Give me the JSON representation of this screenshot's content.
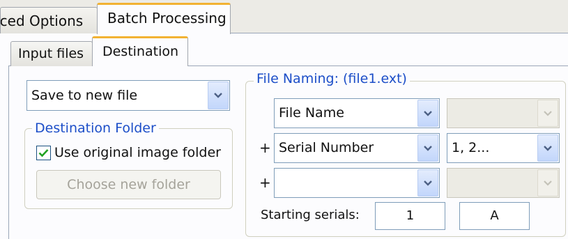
{
  "tabs": {
    "top": [
      {
        "label": "nced Options",
        "active": false
      },
      {
        "label": "Batch Processing",
        "active": true
      }
    ],
    "sub": [
      {
        "label": "Input files",
        "active": false
      },
      {
        "label": "Destination",
        "active": true
      }
    ]
  },
  "destination": {
    "save_mode": {
      "value": "Save to new file"
    },
    "folder_group": {
      "legend": "Destination Folder",
      "use_original": {
        "label": "Use original image folder",
        "checked": true
      },
      "choose_button": {
        "label": "Choose new folder",
        "enabled": false
      }
    }
  },
  "file_naming": {
    "legend": "File Naming: (file1.ext)",
    "rows": [
      {
        "prefix": "",
        "part": "File Name",
        "format": "",
        "format_enabled": false
      },
      {
        "prefix": "+",
        "part": "Serial Number",
        "format": "1, 2...",
        "format_enabled": true
      },
      {
        "prefix": "+",
        "part": "",
        "format": "",
        "format_enabled": false
      }
    ],
    "starting_serials": {
      "label": "Starting serials:",
      "numeric": "1",
      "alpha": "A"
    }
  },
  "colors": {
    "accent_tab": "#f2b233",
    "legend_text": "#1c4ec8",
    "check_mark": "#21a121"
  },
  "icons": {
    "combo_arrow": "chevron-down-icon",
    "checkbox": "check-icon"
  }
}
